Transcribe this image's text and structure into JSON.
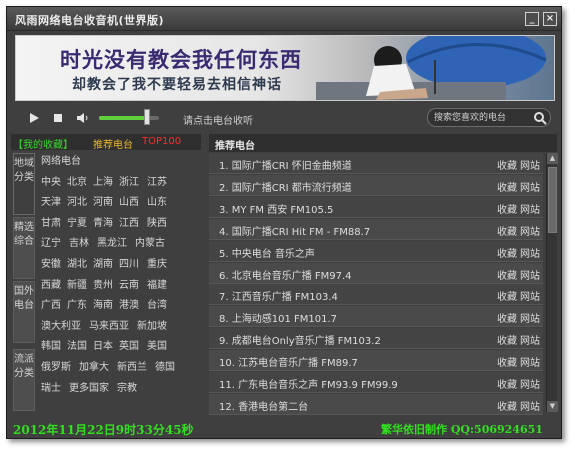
{
  "window": {
    "title": "风雨网络电台收音机(世界版)",
    "minimize_glyph": "_",
    "close_glyph": "×"
  },
  "banner": {
    "line1": "时光没有教会我任何东西",
    "line2": "却教会了我不要轻易去相信神话"
  },
  "player": {
    "play_icon": "play-icon",
    "stop_icon": "stop-icon",
    "volume_icon": "speaker-icon",
    "volume_level": 0.8,
    "hint": "请点击电台收听",
    "search_placeholder": "搜索您喜欢的电台"
  },
  "left_tabs": [
    {
      "label": "【我的收藏】",
      "color": "#37d82a"
    },
    {
      "label": "推荐电台",
      "color": "#e8b72a"
    },
    {
      "label": "TOP100",
      "color": "#ff2a2a"
    }
  ],
  "categories": [
    "地域分类",
    "精选综合",
    "国外电台",
    "流派分类"
  ],
  "regions": [
    [
      "网络电台"
    ],
    [
      "中央",
      "北京",
      "上海",
      "浙江",
      "江苏"
    ],
    [
      "天津",
      "河北",
      "河南",
      "山西",
      "山东"
    ],
    [
      "甘肃",
      "宁夏",
      "青海",
      "江西",
      "陕西"
    ],
    [
      "辽宁",
      "吉林",
      "黑龙江",
      "内蒙古"
    ],
    [
      "安徽",
      "湖北",
      "湖南",
      "四川",
      "重庆"
    ],
    [
      "西藏",
      "新疆",
      "贵州",
      "云南",
      "福建"
    ],
    [
      "广西",
      "广东",
      "海南",
      "港澳",
      "台湾"
    ],
    [
      "澳大利亚",
      "马来西亚",
      "新加坡"
    ],
    [
      "韩国",
      "法国",
      "日本",
      "英国",
      "美国"
    ],
    [
      "俄罗斯",
      "加拿大",
      "新西兰",
      "德国"
    ],
    [
      "瑞士",
      "更多国家",
      "宗教"
    ]
  ],
  "stations_header": "推荐电台",
  "station_actions": {
    "fav": "收藏",
    "site": "网站"
  },
  "stations": [
    "1. 国际广播CRI 怀旧金曲频道",
    "2. 国际广播CRI 都市流行频道",
    "3. MY FM 西安 FM105.5",
    "4. 国际广播CRI Hit FM - FM88.7",
    "5. 中央电台 音乐之声",
    "6. 北京电台音乐广播 FM97.4",
    "7. 江西音乐广播 FM103.4",
    "8. 上海动感101 FM101.7",
    "9. 成都电台Only音乐广播 FM103.2",
    "10. 江苏电台音乐广播 FM89.7",
    "11. 广东电台音乐之声 FM93.9 FM99.9",
    "12. 香港电台第二台"
  ],
  "status": {
    "datetime": "2012年11月22日9时33分45秒",
    "credit": "繁华依旧制作 QQ:506924651"
  },
  "colors": {
    "background": "#3f3f3f",
    "status_green": "#33e01f",
    "banner_purple": "#3a2a72"
  }
}
